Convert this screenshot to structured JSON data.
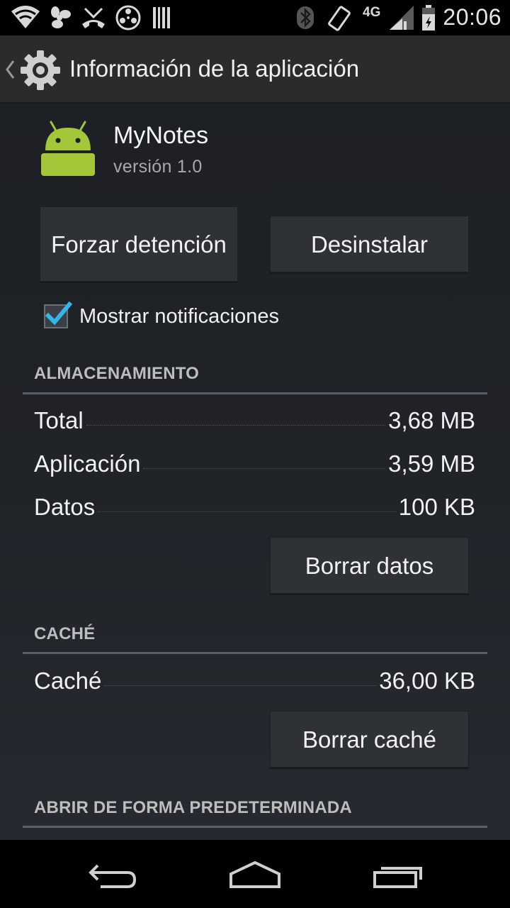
{
  "status_bar": {
    "network": "4G",
    "time": "20:06",
    "icons": [
      "wifi-icon",
      "fan-icon",
      "missed-call-icon",
      "media-icon",
      "barcode-icon",
      "bluetooth-icon",
      "rotate-icon",
      "signal-icon",
      "battery-icon"
    ]
  },
  "action_bar": {
    "title": "Información de la aplicación",
    "icon": "settings-gear-icon"
  },
  "app": {
    "name": "MyNotes",
    "version": "versión 1.0",
    "icon": "android-robot-icon",
    "icon_color": "#a4c639"
  },
  "buttons": {
    "force_stop": "Forzar detención",
    "uninstall": "Desinstalar",
    "clear_data": "Borrar datos",
    "clear_cache": "Borrar caché"
  },
  "notifications": {
    "label": "Mostrar notificaciones",
    "checked": true,
    "check_color": "#33b5e5"
  },
  "storage": {
    "header": "ALMACENAMIENTO",
    "rows": [
      {
        "label": "Total",
        "value": "3,68 MB"
      },
      {
        "label": "Aplicación",
        "value": "3,59 MB"
      },
      {
        "label": "Datos",
        "value": "100 KB"
      }
    ]
  },
  "cache": {
    "header": "CACHÉ",
    "rows": [
      {
        "label": "Caché",
        "value": "36,00 KB"
      }
    ]
  },
  "defaults": {
    "header": "ABRIR DE FORMA PREDETERMINADA"
  },
  "nav_bar": {
    "icons": [
      "back-icon",
      "home-icon",
      "recent-apps-icon"
    ]
  }
}
